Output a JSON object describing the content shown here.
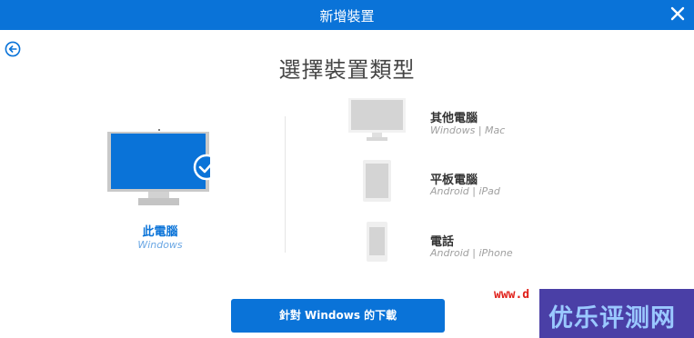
{
  "window": {
    "title": "新增裝置"
  },
  "heading": "選擇裝置類型",
  "selected_device": {
    "name": "此電腦",
    "subtitle": "Windows"
  },
  "options": [
    {
      "name": "其他電腦",
      "subtitle": "Windows | Mac",
      "icon": "monitor-icon"
    },
    {
      "name": "平板電腦",
      "subtitle": "Android | iPad",
      "icon": "tablet-icon"
    },
    {
      "name": "電話",
      "subtitle": "Android | iPhone",
      "icon": "phone-icon"
    }
  ],
  "download_button": {
    "label": "針對 Windows 的下載"
  },
  "watermark": {
    "url": "www.d",
    "text": "优乐评测网"
  },
  "colors": {
    "accent": "#0a73d8",
    "watermark_badge": "#4a3fa6",
    "watermark_url": "#e0201a"
  }
}
